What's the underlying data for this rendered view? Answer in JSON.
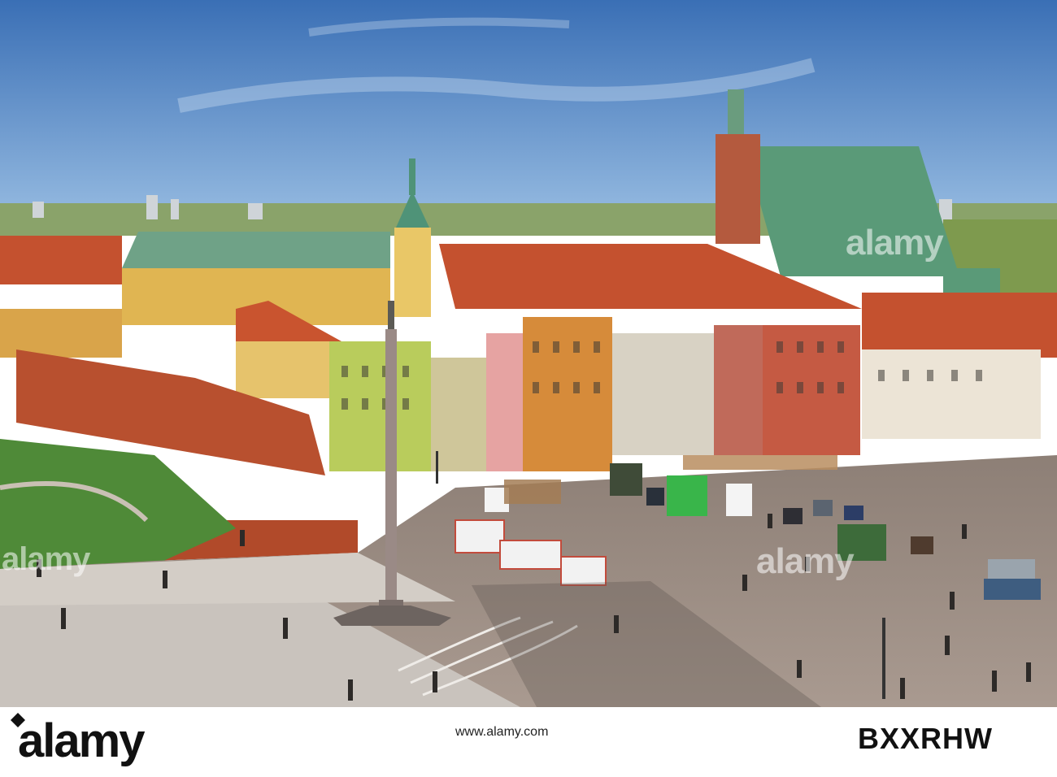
{
  "watermark": {
    "brand": "alamy"
  },
  "footer": {
    "logo_text": "alamy",
    "caption": "www.alamy.com",
    "image_id": "BXXRHW"
  },
  "colors": {
    "sky": "#4a7fc1",
    "roof_red": "#c4512f",
    "roof_copper": "#5a9a78",
    "plaza": "#9a8a80",
    "footer_bg": "#ffffff"
  }
}
